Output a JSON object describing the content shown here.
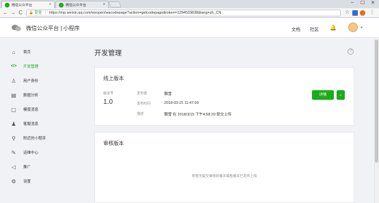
{
  "browser": {
    "tabs": [
      {
        "label": "微信公众平台",
        "close": "×"
      },
      {
        "label": "微信公众平台",
        "close": "×"
      }
    ],
    "window_controls": [
      "–",
      "☐",
      "✕"
    ],
    "nav": {
      "back": "←",
      "forward": "→",
      "reload": "C"
    },
    "url": {
      "secure_label": "安全",
      "separator": "|",
      "text": "https://mp.weixin.qq.com/wxopen/wacodepage?action=getcodepage&token=1294533838&lang=zh_CN"
    }
  },
  "header": {
    "brand": "微信公众平台 | 小程序",
    "links": [
      "文档",
      "社区"
    ]
  },
  "sidebar": {
    "items": [
      {
        "label": "首页",
        "icon": "⌂",
        "active": false
      },
      {
        "label": "开发管理",
        "icon": "</>",
        "active": true
      },
      {
        "label": "用户身份",
        "icon": "♙",
        "active": false
      },
      {
        "label": "数据分析",
        "icon": "▤",
        "active": false
      },
      {
        "label": "模版消息",
        "icon": "▢",
        "active": false
      },
      {
        "label": "客服消息",
        "icon": "♟",
        "active": false
      },
      {
        "label": "附近的小程序",
        "icon": "⚲",
        "active": false
      },
      {
        "label": "运维中心",
        "icon": "✎",
        "active": false
      },
      {
        "label": "推广",
        "icon": "◁",
        "active": false
      },
      {
        "label": "设置",
        "icon": "⚙",
        "active": false
      }
    ]
  },
  "main": {
    "title": "开发管理",
    "help": "?",
    "online": {
      "title": "线上版本",
      "version_label": "版本号",
      "version": "1.0",
      "fields": [
        {
          "label": "发布者",
          "value": "飘雪"
        },
        {
          "label": "发布时间",
          "value": "2018-03-21 11:47:00"
        },
        {
          "label": "描述",
          "value": "飘雪 在 2018/3/15 下午4:58:29 提交上传"
        }
      ],
      "detail_button": "详情",
      "dropdown_button": "⌄"
    },
    "review": {
      "title": "审核版本",
      "empty_text": "你暂无提交审核的版本或者版本已发布上线"
    }
  },
  "colors": {
    "accent": "#1aad19"
  }
}
